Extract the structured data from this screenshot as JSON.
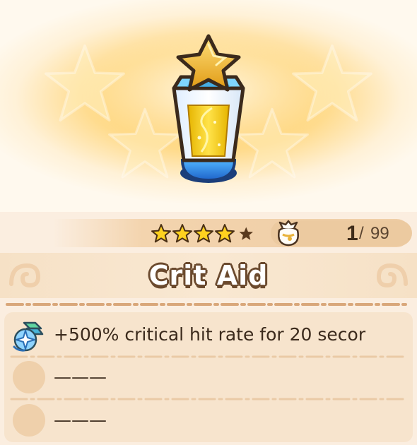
{
  "item": {
    "name": "Crit Aid",
    "rarity_stars": 4,
    "max_stars": 5
  },
  "inventory": {
    "current": "1",
    "separator": "/",
    "max": "99"
  },
  "effects": [
    {
      "icon": "crit-boost-icon",
      "text": "+500% critical hit rate for 20 secor"
    },
    {
      "icon": "empty-slot",
      "text": "———"
    },
    {
      "icon": "empty-slot",
      "text": "———"
    }
  ],
  "colors": {
    "banner_gold": "#ffc653",
    "panel_bg": "#f7e4cd",
    "title_outline": "#6b4a2e",
    "star_gold": "#ffd21f",
    "star_empty": "#5a3a1e"
  },
  "icons": {
    "item_art": "golden-potion-icon",
    "bag": "pouch-icon"
  }
}
